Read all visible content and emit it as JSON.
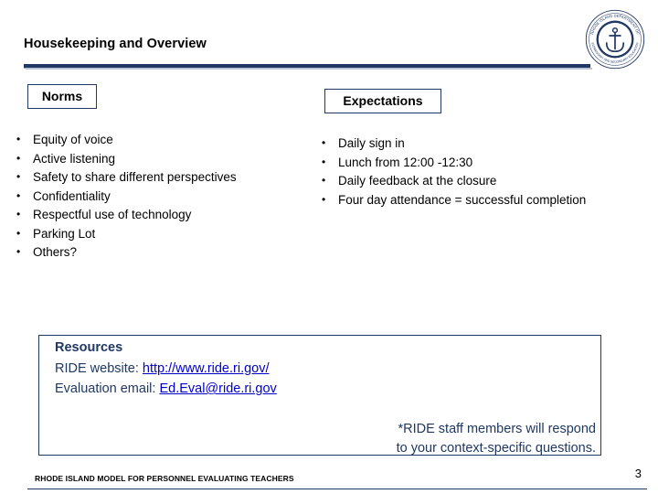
{
  "slide": {
    "title": "Housekeeping and Overview",
    "number": "3",
    "footer": "RHODE ISLAND MODEL FOR PERSONNEL EVALUATING TEACHERS",
    "accent_color": "#1f3864",
    "link_color": "#0000cc"
  },
  "logo": {
    "name": "ride-seal-logo",
    "outer_text_top": "RHODE ISLAND DEPARTMENT OF",
    "outer_text_bottom": "ELEMENTARY AND SECONDARY EDUCATION",
    "glyph": "anchor"
  },
  "columns": {
    "norms": {
      "header": "Norms",
      "items": [
        "Equity of voice",
        "Active listening",
        "Safety to share different perspectives",
        "Confidentiality",
        "Respectful use of technology",
        "Parking Lot",
        "Others?"
      ]
    },
    "expectations": {
      "header": "Expectations",
      "items": [
        "Daily sign in",
        "Lunch from 12:00 -12:30",
        "Daily feedback at the closure",
        "Four day attendance = successful completion"
      ]
    }
  },
  "resources": {
    "title": "Resources",
    "website_label": "RIDE website: ",
    "website_link": "http://www.ride.ri.gov/",
    "email_label": "Evaluation email: ",
    "email_link": "Ed.Eval@ride.ri.gov",
    "note_line_1": "*RIDE staff members will respond",
    "note_line_2": "to your context-specific questions."
  },
  "bullet_glyph": "•"
}
